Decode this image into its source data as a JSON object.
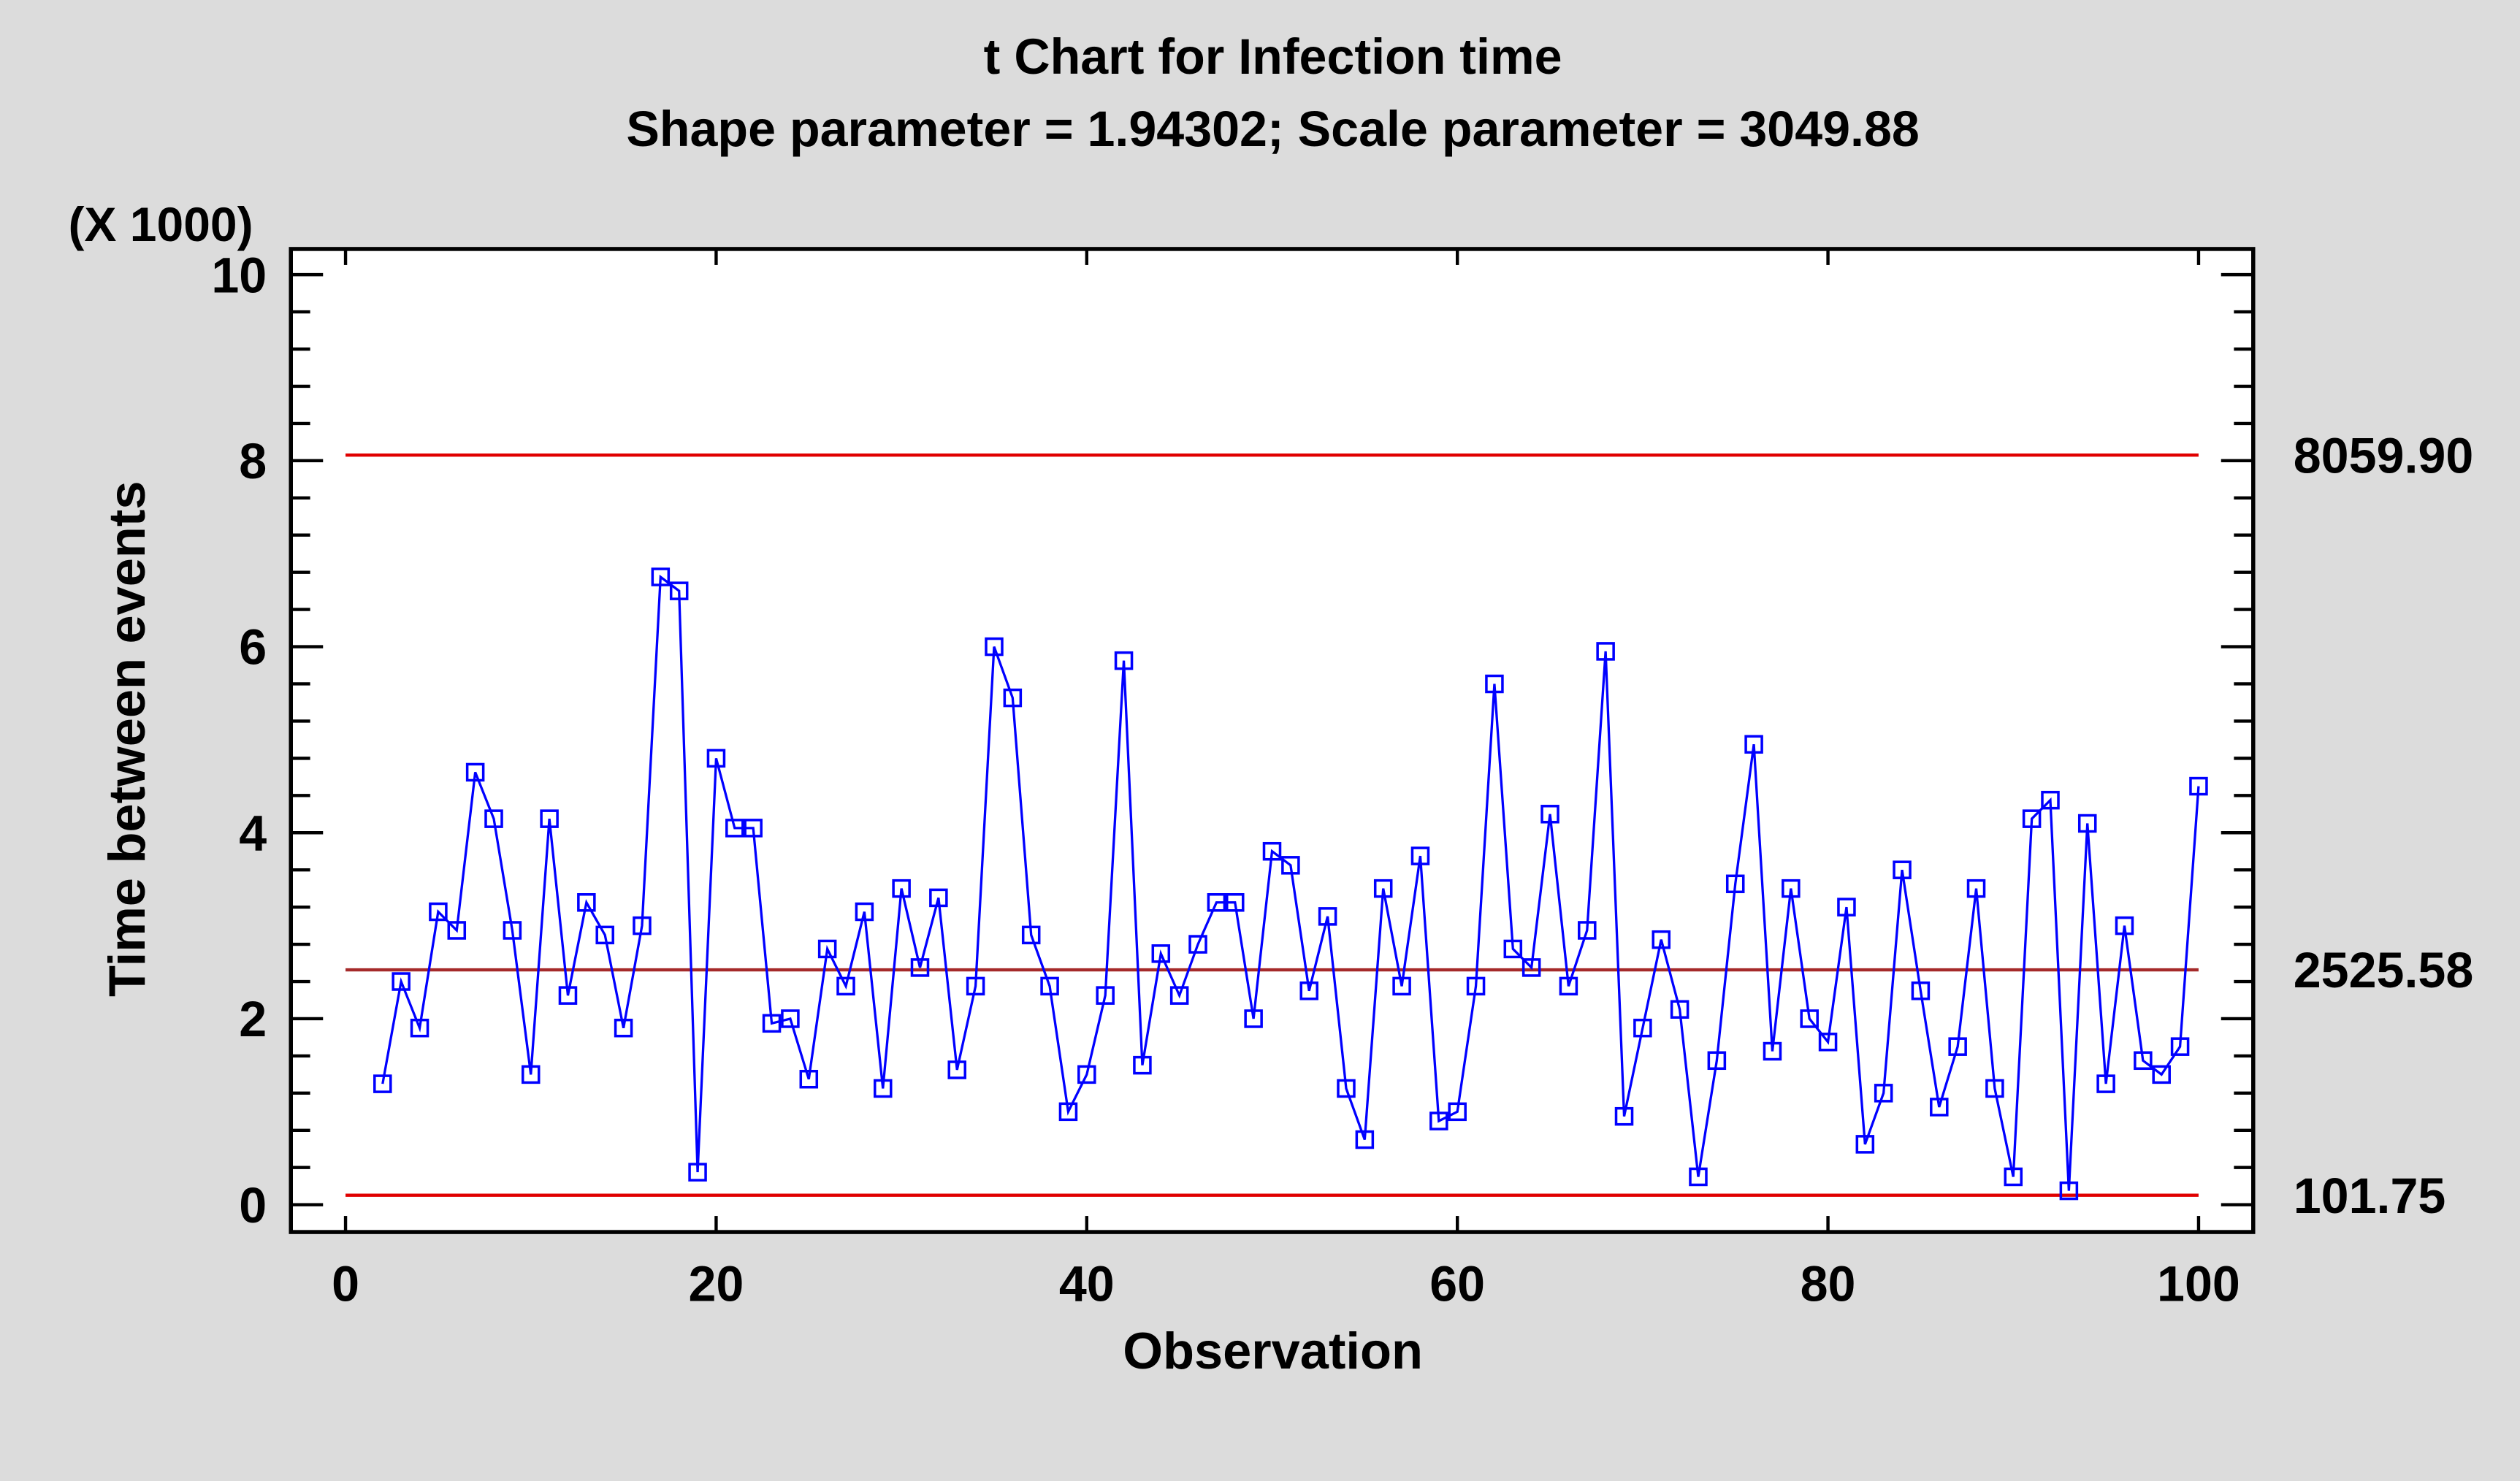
{
  "chart_data": {
    "type": "line",
    "title": "t Chart for Infection time",
    "subtitle": "Shape parameter = 1.94302; Scale parameter = 3049.88",
    "xlabel": "Observation",
    "ylabel": "Time between events",
    "y_multiplier_label": "(X 1000)",
    "xlim": [
      0,
      100
    ],
    "ylim": [
      0,
      10000
    ],
    "x_ticks": [
      0,
      20,
      40,
      60,
      80,
      100
    ],
    "y_ticks": [
      0,
      2,
      4,
      6,
      8,
      10
    ],
    "grid": false,
    "control_limits": [
      {
        "name": "UCL",
        "value": 8059.9,
        "label": "8059.90",
        "color": "#e00000"
      },
      {
        "name": "CL",
        "value": 2525.58,
        "label": "2525.58",
        "color": "#a52a2a"
      },
      {
        "name": "LCL",
        "value": 101.75,
        "label": "101.75",
        "color": "#e00000"
      }
    ],
    "series": [
      {
        "name": "Time between events",
        "color": "#0000ff",
        "marker": "square",
        "x": [
          2,
          3,
          4,
          5,
          6,
          7,
          8,
          9,
          10,
          11,
          12,
          13,
          14,
          15,
          16,
          17,
          18,
          19,
          20,
          21,
          22,
          23,
          24,
          25,
          26,
          27,
          28,
          29,
          30,
          31,
          32,
          33,
          34,
          35,
          36,
          37,
          38,
          39,
          40,
          41,
          42,
          43,
          44,
          45,
          46,
          47,
          48,
          49,
          50,
          51,
          52,
          53,
          54,
          55,
          56,
          57,
          58,
          59,
          60,
          61,
          62,
          63,
          64,
          65,
          66,
          67,
          68,
          69,
          70,
          71,
          72,
          73,
          74,
          75,
          76,
          77,
          78,
          79,
          80,
          81,
          82,
          83,
          84,
          85,
          86,
          87,
          88,
          89,
          90,
          91,
          92,
          93,
          94,
          95,
          96,
          97,
          98,
          99,
          100
        ],
        "values": [
          1300,
          2400,
          1900,
          3150,
          2950,
          4650,
          4150,
          2950,
          1400,
          4150,
          2250,
          3250,
          2900,
          1900,
          3000,
          6750,
          6600,
          350,
          4800,
          4050,
          4050,
          1950,
          2000,
          1350,
          2750,
          2350,
          3150,
          1250,
          3400,
          2550,
          3300,
          1450,
          2350,
          6000,
          5450,
          2900,
          2350,
          1000,
          1400,
          2250,
          5850,
          1500,
          2700,
          2250,
          2800,
          3250,
          3250,
          2000,
          3800,
          3650,
          2300,
          3100,
          1250,
          700,
          3400,
          2350,
          3750,
          900,
          1000,
          2350,
          5600,
          2750,
          2550,
          4200,
          2350,
          2950,
          5950,
          950,
          1900,
          2850,
          2100,
          300,
          1550,
          3450,
          4950,
          1650,
          3400,
          2000,
          1750,
          3200,
          650,
          1200,
          3600,
          2300,
          1050,
          1700,
          3400,
          1250,
          300,
          4150,
          4350,
          150,
          4100,
          1300,
          3000,
          1550,
          1400,
          1700,
          4500
        ]
      }
    ]
  }
}
